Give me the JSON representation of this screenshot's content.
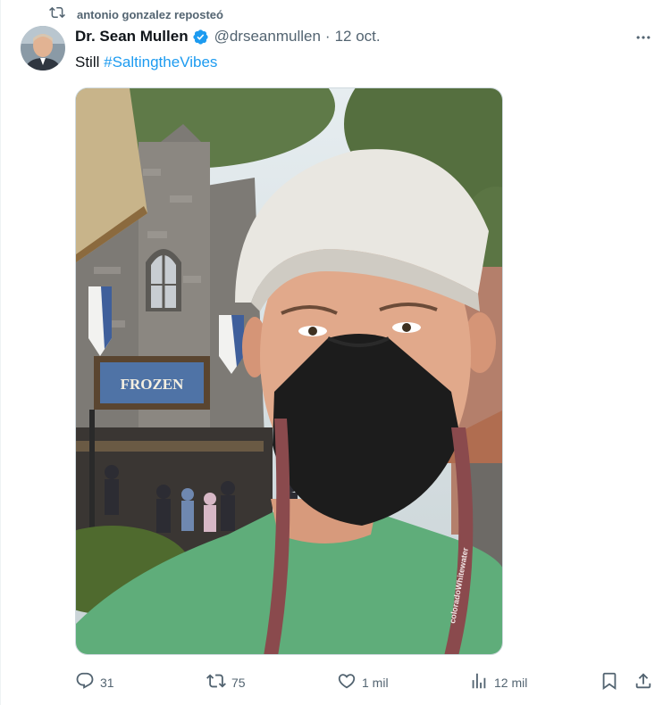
{
  "repost": {
    "label": "antonio gonzalez reposteó",
    "icon": "repost-icon"
  },
  "author": {
    "name": "Dr. Sean Mullen",
    "handle": "@drseanmullen",
    "separator": "·",
    "date": "12 oct.",
    "verified": true
  },
  "tweet": {
    "text": "Still ",
    "hashtag": "#SaltingtheVibes"
  },
  "media": {
    "sign_text": "FROZEN",
    "lanyard_text": "coloradoWhitewater"
  },
  "actions": {
    "replies": "31",
    "reposts": "75",
    "likes": "1 mil",
    "views": "12 mil"
  },
  "colors": {
    "accent": "#1d9bf0",
    "secondary_text": "#536471",
    "primary_text": "#0f1419"
  }
}
